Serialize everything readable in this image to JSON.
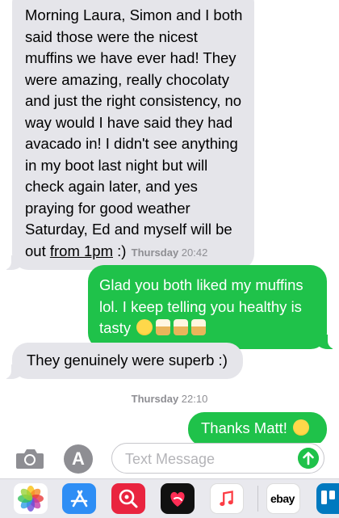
{
  "messages": [
    {
      "dir": "in",
      "text_before": "Morning Laura, Simon and I both said those were the nicest muffins we have ever had! They were amazing, really chocolaty and just the right consistency, no way would I have said they had avacado in! I didn't see anything in my boot last night but will check again later, and yes praying for good weather Saturday, Ed and myself will be out ",
      "text_link": "from 1pm",
      "text_after": " :)"
    },
    {
      "dir": "out",
      "text": "Glad you both liked my muffins lol. I keep telling you healthy is tasty"
    },
    {
      "dir": "in",
      "text": "They genuinely were superb :)"
    },
    {
      "dir": "out",
      "text": "Thanks Matt!"
    }
  ],
  "stamps": [
    {
      "day": "Thursday",
      "time": "20:42"
    },
    {
      "day": "Thursday",
      "time": "22:10"
    }
  ],
  "input": {
    "placeholder": "Text Message",
    "value": ""
  },
  "apps": [
    {
      "name": "Photos",
      "icon": "photos-icon"
    },
    {
      "name": "App Store",
      "icon": "app-store-icon"
    },
    {
      "name": "Search Images",
      "icon": "image-search-icon"
    },
    {
      "name": "Digital Touch",
      "icon": "digital-touch-icon"
    },
    {
      "name": "Music",
      "icon": "music-icon"
    },
    {
      "name": "eBay",
      "icon": "ebay-icon",
      "label": "ebay"
    },
    {
      "name": "Trello",
      "icon": "trello-icon"
    }
  ],
  "colors": {
    "outgoing": "#1fc24a",
    "incoming": "#e5e5ea",
    "stamp": "#8e8e93"
  }
}
